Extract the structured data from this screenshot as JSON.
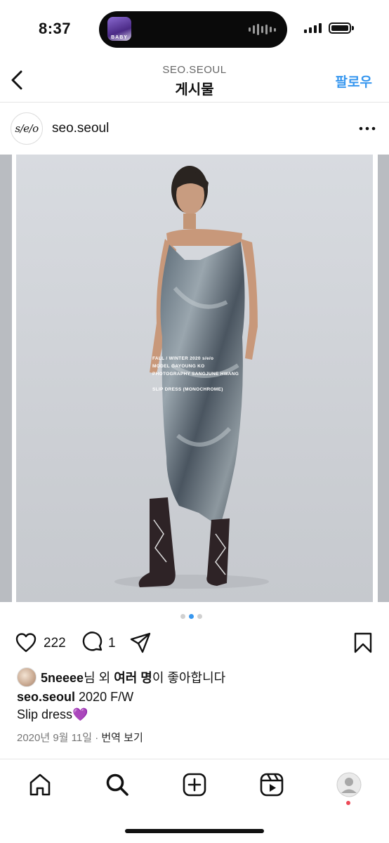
{
  "status_bar": {
    "time": "8:37",
    "island_thumb_text": "BABY"
  },
  "header": {
    "account": "SEO.SEOUL",
    "title": "게시물",
    "follow_label": "팔로우"
  },
  "post": {
    "avatar_text": "s/e/o",
    "username": "seo.seoul",
    "image_caption": [
      "FALL / WINTER 2020 s/e/o",
      "MODEL  GAYOUNG KO",
      "PHOTOGRAPHY  SANGJUNE HWANG",
      "",
      "SLIP DRESS (MONOCHROME)"
    ],
    "carousel": {
      "count": 3,
      "active": 2
    },
    "likes": "222",
    "comments": "1",
    "liked_by": {
      "user": "5neeee",
      "mid": "님 외 ",
      "others": "여러 명",
      "tail": "이 좋아합니다"
    },
    "caption": {
      "user": "seo.seoul",
      "text": " 2020 F/W",
      "line2": "Slip dress💜"
    },
    "date": "2020년 9월 11일",
    "separator": "·",
    "translate": "번역 보기"
  },
  "icons": [
    "chevron-left-icon",
    "more-icon",
    "heart-icon",
    "comment-icon",
    "share-icon",
    "bookmark-icon",
    "home-icon",
    "search-icon",
    "create-icon",
    "reels-icon",
    "profile-icon"
  ],
  "colors": {
    "accent": "#3797ef",
    "notification": "#ed4956"
  }
}
